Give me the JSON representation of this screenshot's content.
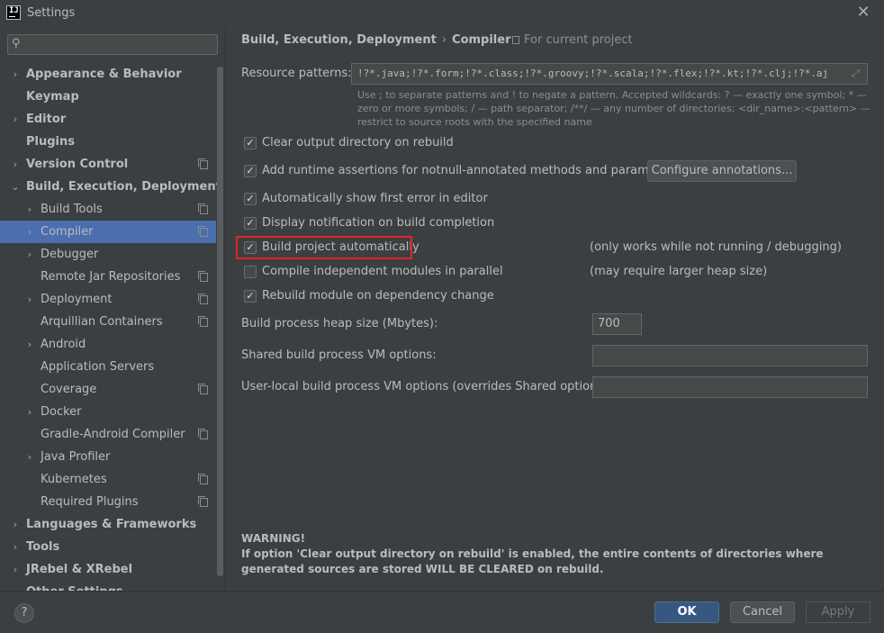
{
  "window": {
    "title": "Settings",
    "close": "✕"
  },
  "sidebar": {
    "search_placeholder": "",
    "items": [
      {
        "label": "Appearance & Behavior",
        "bold": true,
        "chevron": "›",
        "indent": 0,
        "project": false
      },
      {
        "label": "Keymap",
        "bold": true,
        "chevron": "",
        "indent": 0,
        "project": false
      },
      {
        "label": "Editor",
        "bold": true,
        "chevron": "›",
        "indent": 0,
        "project": false
      },
      {
        "label": "Plugins",
        "bold": true,
        "chevron": "",
        "indent": 0,
        "project": false
      },
      {
        "label": "Version Control",
        "bold": true,
        "chevron": "›",
        "indent": 0,
        "project": true
      },
      {
        "label": "Build, Execution, Deployment",
        "bold": true,
        "chevron": "⌄",
        "indent": 0,
        "project": false
      },
      {
        "label": "Build Tools",
        "bold": false,
        "chevron": "›",
        "indent": 1,
        "project": true
      },
      {
        "label": "Compiler",
        "bold": false,
        "chevron": "›",
        "indent": 1,
        "project": true,
        "selected": true
      },
      {
        "label": "Debugger",
        "bold": false,
        "chevron": "›",
        "indent": 1,
        "project": false
      },
      {
        "label": "Remote Jar Repositories",
        "bold": false,
        "chevron": "",
        "indent": 1,
        "project": true
      },
      {
        "label": "Deployment",
        "bold": false,
        "chevron": "›",
        "indent": 1,
        "project": true
      },
      {
        "label": "Arquillian Containers",
        "bold": false,
        "chevron": "",
        "indent": 1,
        "project": true
      },
      {
        "label": "Android",
        "bold": false,
        "chevron": "›",
        "indent": 1,
        "project": false
      },
      {
        "label": "Application Servers",
        "bold": false,
        "chevron": "",
        "indent": 1,
        "project": false
      },
      {
        "label": "Coverage",
        "bold": false,
        "chevron": "",
        "indent": 1,
        "project": true
      },
      {
        "label": "Docker",
        "bold": false,
        "chevron": "›",
        "indent": 1,
        "project": false
      },
      {
        "label": "Gradle-Android Compiler",
        "bold": false,
        "chevron": "",
        "indent": 1,
        "project": true
      },
      {
        "label": "Java Profiler",
        "bold": false,
        "chevron": "›",
        "indent": 1,
        "project": false
      },
      {
        "label": "Kubernetes",
        "bold": false,
        "chevron": "",
        "indent": 1,
        "project": true
      },
      {
        "label": "Required Plugins",
        "bold": false,
        "chevron": "",
        "indent": 1,
        "project": true
      },
      {
        "label": "Languages & Frameworks",
        "bold": true,
        "chevron": "›",
        "indent": 0,
        "project": false
      },
      {
        "label": "Tools",
        "bold": true,
        "chevron": "›",
        "indent": 0,
        "project": false
      },
      {
        "label": "JRebel & XRebel",
        "bold": true,
        "chevron": "›",
        "indent": 0,
        "project": false
      },
      {
        "label": "Other Settings",
        "bold": true,
        "chevron": "›",
        "indent": 0,
        "project": false
      }
    ]
  },
  "header": {
    "crumb_parent": "Build, Execution, Deployment",
    "crumb_sep": "›",
    "crumb_current": "Compiler",
    "for_project": "For current project"
  },
  "compiler": {
    "resource_label": "Resource patterns:",
    "resource_value": "!?*.java;!?*.form;!?*.class;!?*.groovy;!?*.scala;!?*.flex;!?*.kt;!?*.clj;!?*.aj",
    "hint": "Use ; to separate patterns and ! to negate a pattern. Accepted wildcards: ? — exactly one symbol; * — zero or more symbols; / — path separator; /**/ — any number of directories; <dir_name>:<pattern> — restrict to source roots with the specified name",
    "checkboxes": [
      {
        "label": "Clear output directory on rebuild",
        "checked": true
      },
      {
        "label": "Add runtime assertions for notnull-annotated methods and parameters",
        "checked": true
      },
      {
        "label": "Automatically show first error in editor",
        "checked": true
      },
      {
        "label": "Display notification on build completion",
        "checked": true
      },
      {
        "label": "Build project automatically",
        "checked": true
      },
      {
        "label": "Compile independent modules in parallel",
        "checked": false
      },
      {
        "label": "Rebuild module on dependency change",
        "checked": true
      }
    ],
    "configure_button": "Configure annotations...",
    "note_build_auto": "(only works while not running / debugging)",
    "note_parallel": "(may require larger heap size)",
    "heap_label": "Build process heap size (Mbytes):",
    "heap_value": "700",
    "shared_vm_label": "Shared build process VM options:",
    "shared_vm_value": "",
    "local_vm_label": "User-local build process VM options (overrides Shared options):",
    "local_vm_value": "",
    "warning_title": "WARNING!",
    "warning_text": "If option 'Clear output directory on rebuild' is enabled, the entire contents of directories where generated sources are stored WILL BE CLEARED on rebuild."
  },
  "footer": {
    "help": "?",
    "ok": "OK",
    "cancel": "Cancel",
    "apply": "Apply"
  },
  "colors": {
    "background": "#3c3f41",
    "selection": "#4b6eaf",
    "highlight": "#e0232c",
    "ok_button": "#365880"
  }
}
